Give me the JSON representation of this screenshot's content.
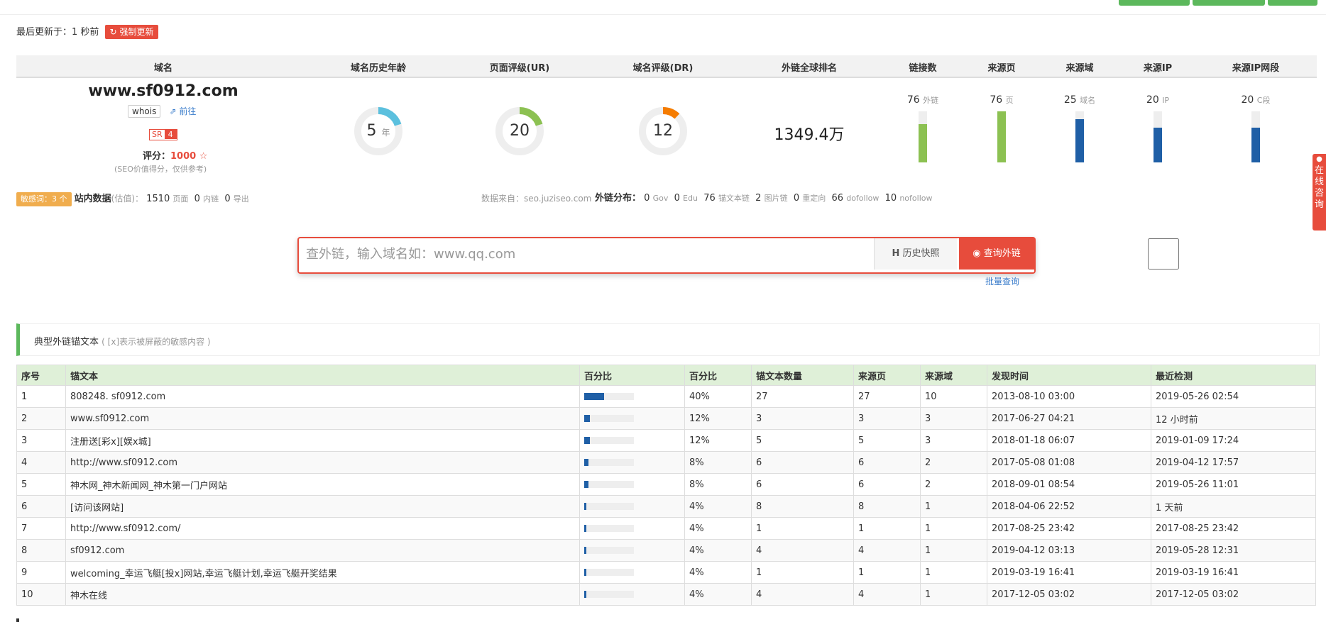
{
  "header": {
    "last_update": "最后更新于：1 秒前",
    "force_update": "强制更新"
  },
  "stats": {
    "columns": [
      "域名",
      "域名历史年龄",
      "页面评级(UR)",
      "域名评级(DR)",
      "外链全球排名",
      "链接数",
      "来源页",
      "来源域",
      "来源IP",
      "来源IP网段"
    ],
    "domain": "www.sf0912.com",
    "whois": "whois",
    "goto": "前往",
    "sr_label": "SR",
    "sr_value": "4",
    "score_label": "评分：",
    "score_value": "1000",
    "score_star": "☆",
    "score_note": "(SEO价值得分，仅供参考)",
    "age": {
      "value": "5",
      "unit": "年",
      "fraction": 0.2,
      "color": "#5bc0de"
    },
    "ur": {
      "value": "20",
      "fraction": 0.2,
      "color": "#8cc152"
    },
    "dr": {
      "value": "12",
      "fraction": 0.12,
      "color": "#f57c00"
    },
    "global_rank": "1349.4万",
    "bars": [
      {
        "value": "76",
        "unit": "外链",
        "level": 0.75,
        "color": "#8cc152"
      },
      {
        "value": "76",
        "unit": "页",
        "level": 1.0,
        "color": "#8cc152"
      },
      {
        "value": "25",
        "unit": "域名",
        "level": 0.85,
        "color": "#1f5fa6"
      },
      {
        "value": "20",
        "unit": "IP",
        "level": 0.68,
        "color": "#1f5fa6"
      },
      {
        "value": "20",
        "unit": "C段",
        "level": 0.68,
        "color": "#1f5fa6"
      }
    ]
  },
  "info": {
    "sensitive": "敏感词：3 个",
    "site_label": "站内数据",
    "site_est": "(估值)：",
    "pages": "1510",
    "pages_unit": "页面",
    "inner": "0",
    "inner_unit": "内链",
    "export": "0",
    "export_unit": "导出",
    "source": "数据来自：seo.juziseo.com",
    "dist_label": "外链分布：",
    "dist": [
      {
        "n": "0",
        "u": "Gov"
      },
      {
        "n": "0",
        "u": "Edu"
      },
      {
        "n": "76",
        "u": "锚文本链"
      },
      {
        "n": "2",
        "u": "图片链"
      },
      {
        "n": "0",
        "u": "重定向"
      },
      {
        "n": "66",
        "u": "dofollow"
      },
      {
        "n": "10",
        "u": "nofollow"
      }
    ]
  },
  "search": {
    "placeholder": "查外链，输入域名如：www.qq.com",
    "history_icon": "H",
    "history_label": "历史快照",
    "query_button": "查询外链",
    "batch": "批量查询"
  },
  "anchor_panel": {
    "title": "典型外链锚文本",
    "subtitle": "( [x]表示被屏蔽的敏感内容 )"
  },
  "table": {
    "headers": [
      "序号",
      "锚文本",
      "百分比",
      "百分比",
      "锚文本数量",
      "来源页",
      "来源域",
      "发现时间",
      "最近检测"
    ],
    "rows": [
      {
        "idx": "1",
        "text": "808248. sf0912.com",
        "bar": 0.4,
        "pct": "40%",
        "count": "27",
        "pages": "27",
        "domains": "10",
        "found": "2013-08-10 03:00",
        "checked": "2019-05-26 02:54"
      },
      {
        "idx": "2",
        "text": "www.sf0912.com",
        "bar": 0.12,
        "pct": "12%",
        "count": "3",
        "pages": "3",
        "domains": "3",
        "found": "2017-06-27 04:21",
        "checked": "12 小时前"
      },
      {
        "idx": "3",
        "text": "注册送[彩x][娱x城]",
        "bar": 0.12,
        "pct": "12%",
        "count": "5",
        "pages": "5",
        "domains": "3",
        "found": "2018-01-18 06:07",
        "checked": "2019-01-09 17:24"
      },
      {
        "idx": "4",
        "text": "http://www.sf0912.com",
        "bar": 0.08,
        "pct": "8%",
        "count": "6",
        "pages": "6",
        "domains": "2",
        "found": "2017-05-08 01:08",
        "checked": "2019-04-12 17:57"
      },
      {
        "idx": "5",
        "text": "神木网_神木新闻网_神木第一门户网站",
        "bar": 0.08,
        "pct": "8%",
        "count": "6",
        "pages": "6",
        "domains": "2",
        "found": "2018-09-01 08:54",
        "checked": "2019-05-26 11:01"
      },
      {
        "idx": "6",
        "text": "[访问该网站]",
        "bar": 0.04,
        "pct": "4%",
        "count": "8",
        "pages": "8",
        "domains": "1",
        "found": "2018-04-06 22:52",
        "checked": "1 天前"
      },
      {
        "idx": "7",
        "text": "http://www.sf0912.com/",
        "bar": 0.04,
        "pct": "4%",
        "count": "1",
        "pages": "1",
        "domains": "1",
        "found": "2017-08-25 23:42",
        "checked": "2017-08-25 23:42"
      },
      {
        "idx": "8",
        "text": "sf0912.com",
        "bar": 0.04,
        "pct": "4%",
        "count": "4",
        "pages": "4",
        "domains": "1",
        "found": "2019-04-12 03:13",
        "checked": "2019-05-28 12:31"
      },
      {
        "idx": "9",
        "text": "welcoming_幸运飞艇[投x]网站,幸运飞艇计划,幸运飞艇开奖结果",
        "bar": 0.04,
        "pct": "4%",
        "count": "1",
        "pages": "1",
        "domains": "1",
        "found": "2019-03-19 16:41",
        "checked": "2019-03-19 16:41"
      },
      {
        "idx": "10",
        "text": "神木在线",
        "bar": 0.04,
        "pct": "4%",
        "count": "4",
        "pages": "4",
        "domains": "1",
        "found": "2017-12-05 03:02",
        "checked": "2017-12-05 03:02"
      }
    ]
  },
  "side": {
    "label": "在线咨询"
  }
}
